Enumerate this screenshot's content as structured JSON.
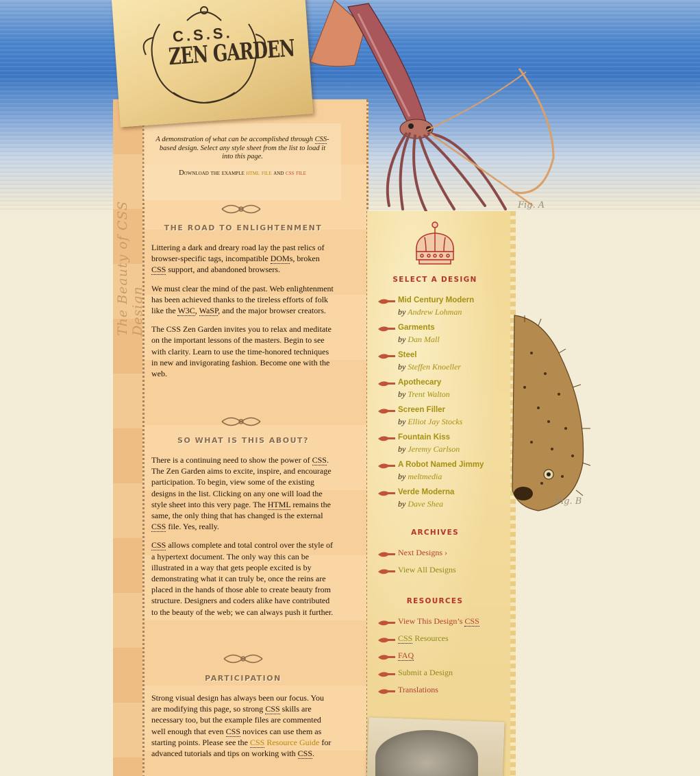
{
  "logo": {
    "line1": "C.S.S.",
    "line2": "ZEN GARDEN"
  },
  "vertical_text": "The Beauty of CSS Design",
  "intro": {
    "text_before": "A demonstration of what can be accomplished through ",
    "css_abbr": "CSS",
    "text_after": "-based design. Select any style sheet from the list to load it into this page.",
    "download_prefix": "Download the example ",
    "html_file": "html file",
    "and": " and ",
    "css_file": "css file"
  },
  "sections": {
    "road": {
      "heading": "The Road to Enlightenment",
      "p1_a": "Littering a dark and dreary road lay the past relics of browser-specific tags, incompatible ",
      "p1_doms": "DOM",
      "p1_b": "s, broken ",
      "p1_css": "CSS",
      "p1_c": " support, and abandoned browsers.",
      "p2_a": "We must clear the mind of the past. Web enlightenment has been achieved thanks to the tireless efforts of folk like the ",
      "p2_w3c": "W3C",
      "p2_sep": ", ",
      "p2_wasp": "WaSP",
      "p2_b": ", and the major browser creators.",
      "p3": "The CSS Zen Garden invites you to relax and meditate on the important lessons of the masters. Begin to see with clarity. Learn to use the time-honored techniques in new and invigorating fashion. Become one with the web."
    },
    "about": {
      "heading": "So What is This About?",
      "p1_a": "There is a continuing need to show the power of ",
      "p1_css": "CSS",
      "p1_b": ". The Zen Garden aims to excite, inspire, and encourage participation. To begin, view some of the existing designs in the list. Clicking on any one will load the style sheet into this very page. The ",
      "p1_html": "HTML",
      "p1_c": " remains the same, the only thing that has changed is the external ",
      "p1_css2": "CSS",
      "p1_d": " file. Yes, really.",
      "p2_css": "CSS",
      "p2": " allows complete and total control over the style of a hypertext document. The only way this can be illustrated in a way that gets people excited is by demonstrating what it can truly be, once the reins are placed in the hands of those able to create beauty from structure. Designers and coders alike have contributed to the beauty of the web; we can always push it further."
    },
    "participation": {
      "heading": "Participation",
      "p1_a": "Strong visual design has always been our focus. You are modifying this page, so strong ",
      "p1_css": "CSS",
      "p1_b": " skills are necessary too, but the example files are commented well enough that even ",
      "p1_css2": "CSS",
      "p1_c": " novices can use them as starting points. Please see the ",
      "p1_link_css": "CSS",
      "p1_link": " Resource Guide",
      "p1_d": " for advanced tutorials and tips on working with ",
      "p1_css3": "CSS",
      "p1_e": "."
    }
  },
  "sidebar": {
    "select_heading": "Select a Design",
    "by": "by",
    "designs": [
      {
        "name": "Mid Century Modern",
        "author": "Andrew Lohman"
      },
      {
        "name": "Garments",
        "author": "Dan Mall"
      },
      {
        "name": "Steel",
        "author": "Steffen Knoeller"
      },
      {
        "name": "Apothecary",
        "author": "Trent Walton"
      },
      {
        "name": "Screen Filler",
        "author": "Elliot Jay Stocks"
      },
      {
        "name": "Fountain Kiss",
        "author": "Jeremy Carlson"
      },
      {
        "name": "A Robot Named Jimmy",
        "author": "meltmedia"
      },
      {
        "name": "Verde Moderna",
        "author": "Dave Shea"
      }
    ],
    "archives_heading": "Archives",
    "archives": [
      {
        "label": "Next Designs ›"
      },
      {
        "label": "View All Designs"
      }
    ],
    "resources_heading": "Resources",
    "resources": [
      {
        "label": "View This Design’s ",
        "abbr": "CSS"
      },
      {
        "label": " Resources",
        "abbr_first": "CSS"
      },
      {
        "label": "FAQ"
      },
      {
        "label": "Submit a Design"
      },
      {
        "label": "Translations"
      }
    ]
  },
  "figures": {
    "fig_a": "Fig. A",
    "fig_b": "Fig. B"
  },
  "colors": {
    "accent_red": "#b2352a",
    "link_olive": "#a59012",
    "ocean_blue": "#3d78c6"
  }
}
